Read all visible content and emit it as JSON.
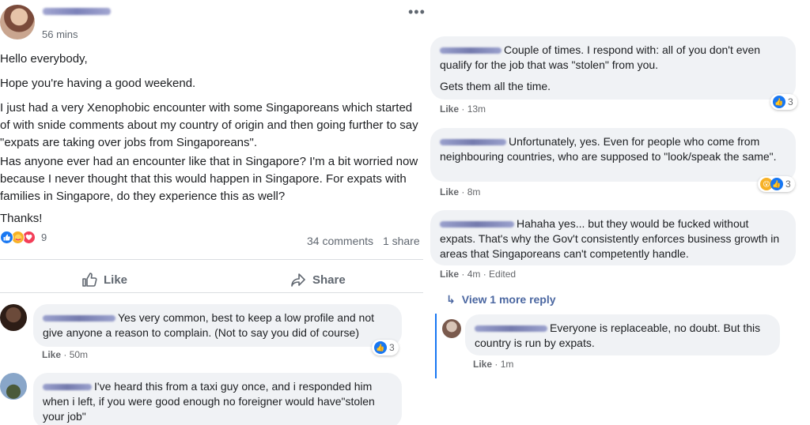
{
  "post": {
    "time": "56 mins",
    "more": "•••",
    "paragraphs": [
      "Hello everybody,",
      "Hope you're having a good weekend.",
      "I just had a very Xenophobic encounter with some Singaporeans which started of with snide comments about my country of origin and then going further to say \"expats are taking over jobs from Singaporeans\".",
      "Has anyone ever had an encounter like that in Singapore? I'm a bit worried now because I never thought that this would happen in Singapore. For expats with families in Singapore, do they experience this as well?",
      "Thanks!"
    ],
    "reactions_count": "9",
    "comments_count": "34 comments",
    "shares_count": "1 share",
    "like_label": "Like",
    "share_label": "Share"
  },
  "comments_left": [
    {
      "text": "Yes very common, best to keep a low profile and not give anyone a reason to complain. (Not to say you did of course)",
      "like": "Like",
      "time": "50m",
      "reactions": "3"
    },
    {
      "text": "I've heard this from a taxi guy once, and i responded him when i left, if you were good enough no foreigner would have\"stolen your job\""
    }
  ],
  "comments_right": [
    {
      "text": "Couple of times. I respond with: all of you don't even qualify for the job that was \"stolen\" from you.",
      "text2": "Gets them all the time.",
      "like": "Like",
      "time": "13m",
      "reactions": "3"
    },
    {
      "text": "Unfortunately, yes. Even for people who come from neighbouring countries, who are supposed to \"look/speak the same\".",
      "like": "Like",
      "time": "8m",
      "reactions": "3"
    },
    {
      "text": "Hahaha yes... but they would be fucked without expats. That's why the Gov't consistently enforces business growth in areas that Singaporeans can't competently handle.",
      "like": "Like",
      "time": "4m",
      "edited": "Edited"
    }
  ],
  "view_more_replies": "View 1 more reply",
  "reply": {
    "text": "Everyone is replaceable, no doubt. But this country is run by expats.",
    "like": "Like",
    "time": "1m"
  },
  "colors": {
    "like_blue": "#1877f2",
    "bubble_bg": "#f0f2f5",
    "meta_grey": "#65676b",
    "link_blue": "#4b67a1"
  }
}
